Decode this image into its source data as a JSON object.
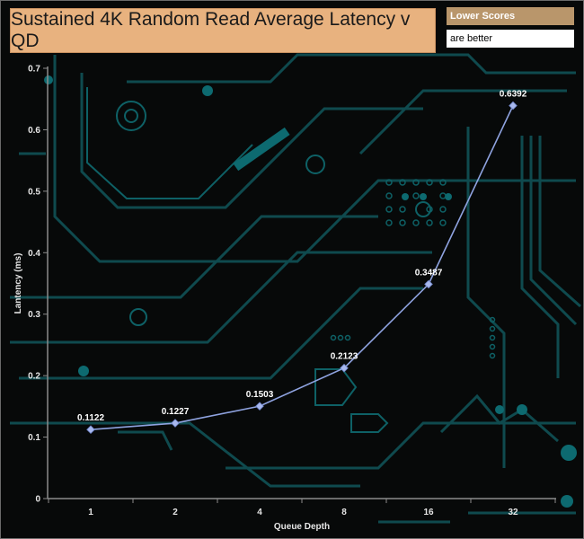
{
  "chart_data": {
    "type": "line",
    "title": "Sustained 4K Random Read Average Latency v QD",
    "xlabel": "Queue Depth",
    "ylabel": "Lantency (ms)",
    "categories": [
      "1",
      "2",
      "4",
      "8",
      "16",
      "32"
    ],
    "series": [
      {
        "values": [
          0.1122,
          0.1227,
          0.1503,
          0.2123,
          0.3487,
          0.6392
        ]
      }
    ],
    "data_labels": [
      "0.1122",
      "0.1227",
      "0.1503",
      "0.2123",
      "0.3487",
      "0.6392"
    ],
    "ylim": [
      0,
      0.7
    ],
    "yticks": [
      0,
      0.1,
      0.2,
      0.3,
      0.4,
      0.5,
      0.6,
      0.7
    ],
    "ytick_labels": [
      "0",
      "0.1",
      "0.2",
      "0.3",
      "0.4",
      "0.5",
      "0.6",
      "0.7"
    ],
    "grid": false,
    "line_color": "#8fa3e0",
    "marker_color": "#a8b8ee"
  },
  "legend_note": {
    "line1": "Lower Scores",
    "line2": "are better"
  }
}
